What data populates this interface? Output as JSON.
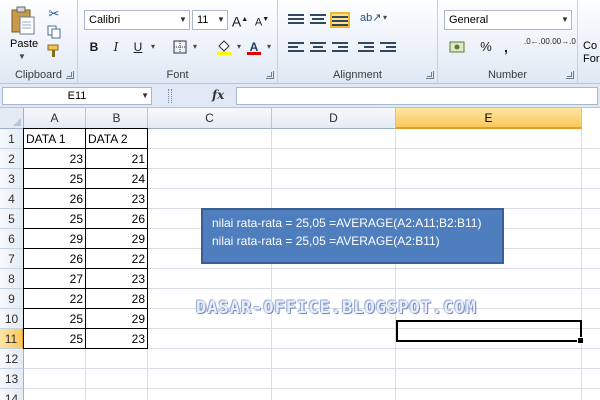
{
  "ribbon": {
    "clipboard": {
      "paste_label": "Paste",
      "group_label": "Clipboard",
      "icons": [
        "paste-icon",
        "cut-icon",
        "copy-icon",
        "format-painter-icon"
      ]
    },
    "font": {
      "font_name": "Calibri",
      "font_size": "11",
      "bold": "B",
      "italic": "I",
      "underline": "U",
      "grow": "A",
      "shrink": "A",
      "font_color_letter": "A",
      "group_label": "Font"
    },
    "alignment": {
      "group_label": "Alignment"
    },
    "number": {
      "format": "General",
      "percent": "%",
      "comma": ",",
      "inc_decimal": ".0←.00",
      "dec_decimal": ".00→.0",
      "group_label": "Number"
    },
    "styles": {
      "partial_label_1": "Co",
      "partial_label_2": "For"
    }
  },
  "formula_bar": {
    "name_box": "E11",
    "fx": "fx",
    "formula": ""
  },
  "sheet": {
    "columns": [
      "A",
      "B",
      "C",
      "D",
      "E"
    ],
    "active_column": "E",
    "rows": [
      "1",
      "2",
      "3",
      "4",
      "5",
      "6",
      "7",
      "8",
      "9",
      "10",
      "11",
      "12",
      "13",
      "14"
    ],
    "active_row": "11",
    "headers": [
      "DATA 1",
      "DATA 2"
    ],
    "data": [
      [
        23,
        21
      ],
      [
        25,
        24
      ],
      [
        26,
        23
      ],
      [
        25,
        26
      ],
      [
        29,
        29
      ],
      [
        26,
        22
      ],
      [
        27,
        23
      ],
      [
        22,
        28
      ],
      [
        25,
        29
      ],
      [
        25,
        23
      ]
    ]
  },
  "text_box": {
    "line1": "nilai rata-rata = 25,05 =AVERAGE(A2:A11;B2:B11)",
    "line2": "nilai rata-rata = 25,05 =AVERAGE(A2:B11)",
    "fill_color": "#4f7ebf"
  },
  "watermark": "DASAR-OFFICE.BLOGSPOT.COM",
  "colors": {
    "ribbon_bg": "#dfe8f4",
    "active_header": "#f9c85d",
    "shape_fill": "#4f7ebf"
  }
}
